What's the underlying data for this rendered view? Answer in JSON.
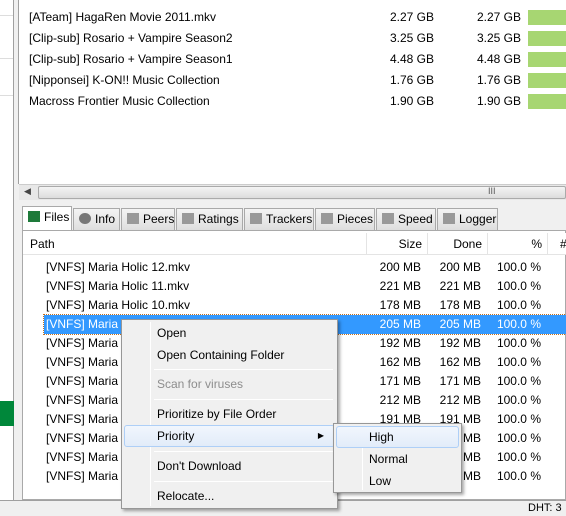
{
  "torrents": [
    {
      "name": "[ATeam] HagaRen Movie 2011.mkv",
      "size": "2.27 GB",
      "done": "2.27 GB",
      "progress": 100
    },
    {
      "name": "[Clip-sub] Rosario + Vampire Season2",
      "size": "3.25 GB",
      "done": "3.25 GB",
      "progress": 100
    },
    {
      "name": "[Clip-sub] Rosario + Vampire Season1",
      "size": "4.48 GB",
      "done": "4.48 GB",
      "progress": 100
    },
    {
      "name": "[Nipponsei] K-ON!! Music Collection",
      "size": "1.76 GB",
      "done": "1.76 GB",
      "progress": 100
    },
    {
      "name": "Macross Frontier Music Collection",
      "size": "1.90 GB",
      "done": "1.90 GB",
      "progress": 100
    }
  ],
  "scroll_grip": "III",
  "tabs": [
    {
      "label": "Files",
      "icon": "folder-icon",
      "color": "#1e7a3a"
    },
    {
      "label": "Info",
      "icon": "info-icon",
      "color": "#777"
    },
    {
      "label": "Peers",
      "icon": "peers-icon",
      "color": "#999"
    },
    {
      "label": "Ratings",
      "icon": "ratings-icon",
      "color": "#999"
    },
    {
      "label": "Trackers",
      "icon": "trackers-icon",
      "color": "#999"
    },
    {
      "label": "Pieces",
      "icon": "pieces-icon",
      "color": "#999"
    },
    {
      "label": "Speed",
      "icon": "speed-icon",
      "color": "#999"
    },
    {
      "label": "Logger",
      "icon": "logger-icon",
      "color": "#999"
    }
  ],
  "columns": {
    "path": "Path",
    "size": "Size",
    "done": "Done",
    "percent": "%",
    "num": "#"
  },
  "files": [
    {
      "name": "[VNFS] Maria Holic 12.mkv",
      "size": "200 MB",
      "done": "200 MB",
      "pct": "100.0 %"
    },
    {
      "name": "[VNFS] Maria Holic 11.mkv",
      "size": "221 MB",
      "done": "221 MB",
      "pct": "100.0 %"
    },
    {
      "name": "[VNFS] Maria Holic 10.mkv",
      "size": "178 MB",
      "done": "178 MB",
      "pct": "100.0 %"
    },
    {
      "name": "[VNFS] Maria H",
      "size": "205 MB",
      "done": "205 MB",
      "pct": "100.0 %"
    },
    {
      "name": "[VNFS] Maria H",
      "size": "192 MB",
      "done": "192 MB",
      "pct": "100.0 %"
    },
    {
      "name": "[VNFS] Maria H",
      "size": "162 MB",
      "done": "162 MB",
      "pct": "100.0 %"
    },
    {
      "name": "[VNFS] Maria H",
      "size": "171 MB",
      "done": "171 MB",
      "pct": "100.0 %"
    },
    {
      "name": "[VNFS] Maria H",
      "size": "212 MB",
      "done": "212 MB",
      "pct": "100.0 %"
    },
    {
      "name": "[VNFS] Maria H",
      "size": "191 MB",
      "done": "191 MB",
      "pct": "100.0 %"
    },
    {
      "name": "[VNFS] Maria H",
      "size": "",
      "done": "MB",
      "pct": "100.0 %"
    },
    {
      "name": "[VNFS] Maria H",
      "size": "",
      "done": "MB",
      "pct": "100.0 %"
    },
    {
      "name": "[VNFS] Maria H",
      "size": "",
      "done": "MB",
      "pct": "100.0 %"
    }
  ],
  "context_menu": {
    "open": "Open",
    "open_folder": "Open Containing Folder",
    "scan": "Scan for viruses",
    "prioritize": "Prioritize by File Order",
    "priority": "Priority",
    "dont_download": "Don't Download",
    "relocate": "Relocate..."
  },
  "priority_submenu": {
    "high": "High",
    "normal": "Normal",
    "low": "Low"
  },
  "status": {
    "dht": "DHT: 3"
  },
  "colors": {
    "selection": "#3399ff",
    "progress": "#a7d672"
  }
}
